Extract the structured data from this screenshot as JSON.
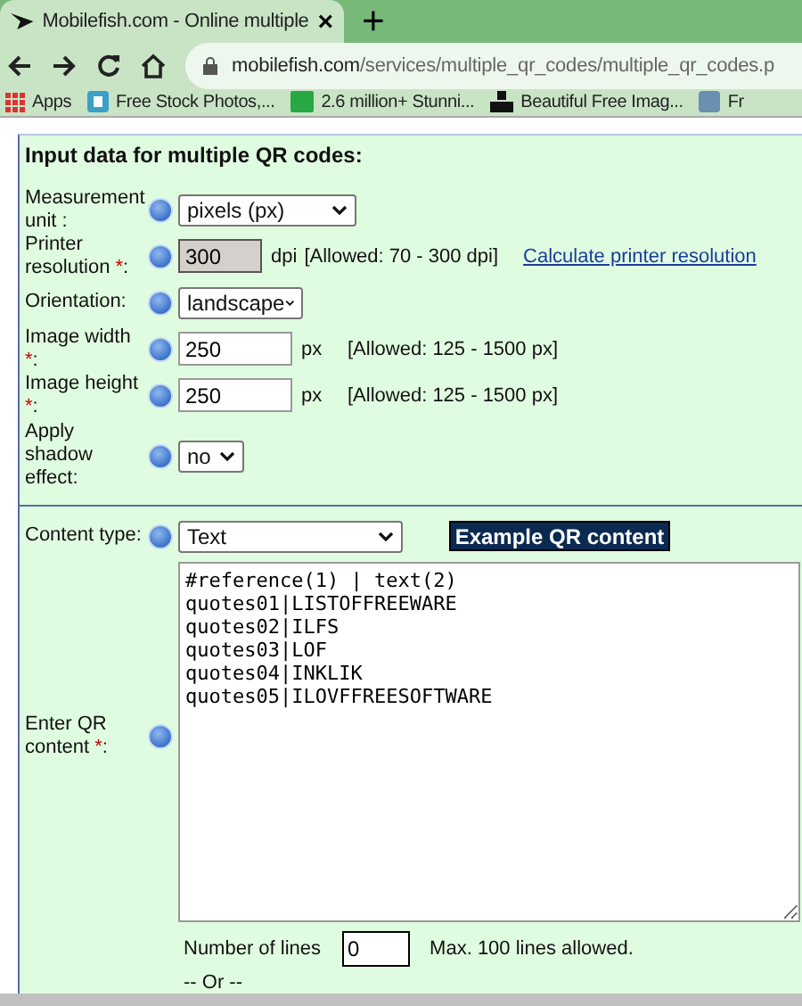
{
  "browser": {
    "tab": {
      "title": "Mobilefish.com - Online multiple",
      "close": "×",
      "selected": true
    },
    "new_tab": "+",
    "url": {
      "host": "mobilefish.com",
      "path": "/services/multiple_qr_codes/multiple_qr_codes.p"
    },
    "bookmarks": [
      {
        "label": "Apps",
        "kind": "apps"
      },
      {
        "label": "Free Stock Photos,...",
        "kind": "page"
      },
      {
        "label": "2.6 million+ Stunni...",
        "kind": "px"
      },
      {
        "label": "Beautiful Free Imag...",
        "kind": "camera"
      },
      {
        "label": "Fr",
        "kind": "image"
      }
    ]
  },
  "form": {
    "title": "Input data for multiple QR codes:",
    "fields": [
      {
        "label": "Measurement unit :",
        "kind": "select",
        "value": "pixels (px)"
      },
      {
        "label": "Printer resolution ",
        "mark": "*",
        "end": ":",
        "kind": "readonly",
        "value": "300",
        "unit": "dpi",
        "allowed": "[Allowed: 70 - 300 dpi]",
        "link": "Calculate printer resolution"
      },
      {
        "label": "Orientation:",
        "kind": "select",
        "value": "landscape"
      },
      {
        "label": "Image width ",
        "mark": "*",
        "end": ":",
        "kind": "input",
        "value": "250",
        "unit": "px",
        "allowed": "[Allowed: 125 - 1500 px]"
      },
      {
        "label": "Image height ",
        "mark": "*",
        "end": ":",
        "kind": "input",
        "value": "250",
        "unit": "px",
        "allowed": "[Allowed: 125 - 1500 px]"
      },
      {
        "label": "Apply shadow effect:",
        "kind": "select",
        "value": "no"
      }
    ],
    "content_type": {
      "label": "Content type:",
      "value": "Text",
      "button": "Example QR content"
    },
    "content": {
      "label": "Enter QR content ",
      "mark": "*",
      "end": ":",
      "lines": [
        "#reference(1) | text(2)",
        "quotes01|LISTOFFREEWARE",
        "quotes02|ILFS",
        "quotes03|LOF",
        "quotes04|INKLIK",
        "quotes05|ILOVFFREESOFTWARE"
      ]
    },
    "lines_count": {
      "label": "Number of lines",
      "value": "0",
      "note": "Max. 100 lines allowed."
    },
    "or": "-- Or --"
  }
}
